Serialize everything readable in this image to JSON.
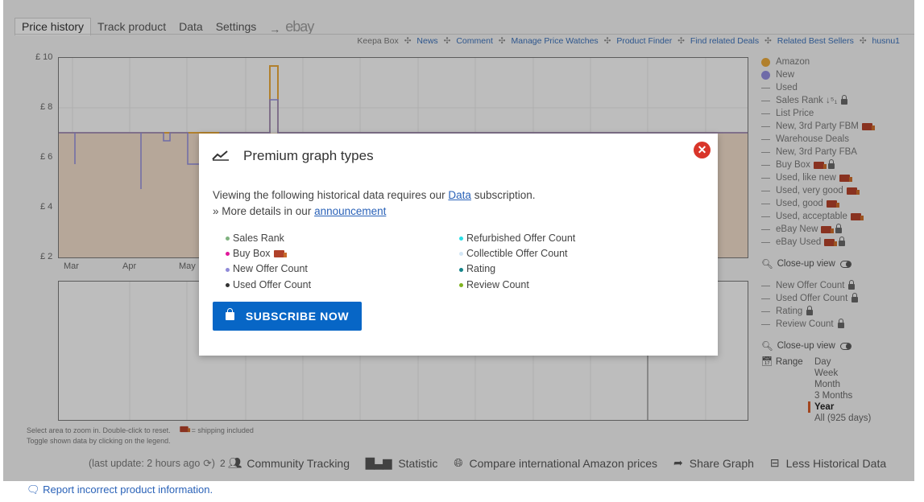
{
  "tabs": [
    {
      "label": "Price history",
      "active": true
    },
    {
      "label": "Track product"
    },
    {
      "label": "Data"
    },
    {
      "label": "Settings"
    }
  ],
  "tab_arrow": "→",
  "ebay_label": "ebay",
  "toplinks": {
    "keepa_box": "Keepa Box",
    "news": "News",
    "comment": "Comment",
    "manage": "Manage Price Watches",
    "finder": "Product Finder",
    "deals": "Find related Deals",
    "sellers": "Related Best Sellers",
    "user": "husnu1",
    "separator": "✣"
  },
  "chart1": {
    "yticks": [
      "£ 10",
      "£ 8",
      "£ 6",
      "£ 4",
      "£ 2"
    ],
    "xticks": [
      "Mar",
      "Apr",
      "May"
    ]
  },
  "legend": {
    "items": [
      {
        "label": "Amazon",
        "kind": "dot",
        "color": "#e3a53a"
      },
      {
        "label": "New",
        "kind": "dot",
        "color": "#8f8ad8"
      },
      {
        "label": "Used",
        "kind": "dash"
      },
      {
        "label": "Sales Rank ↓⁵₁",
        "kind": "dash",
        "lock": true
      },
      {
        "label": "List Price",
        "kind": "dash"
      },
      {
        "label": "New, 3rd Party FBM",
        "kind": "dash",
        "truck": true
      },
      {
        "label": "Warehouse Deals",
        "kind": "dash"
      },
      {
        "label": "New, 3rd Party FBA",
        "kind": "dash"
      },
      {
        "label": "Buy Box",
        "kind": "dash",
        "truck": true,
        "lock": true
      },
      {
        "label": "Used, like new",
        "kind": "dash",
        "truck": true
      },
      {
        "label": "Used, very good",
        "kind": "dash",
        "truck": true
      },
      {
        "label": "Used, good",
        "kind": "dash",
        "truck": true
      },
      {
        "label": "Used, acceptable",
        "kind": "dash",
        "truck": true
      },
      {
        "label": "eBay New",
        "kind": "dash",
        "truck": true,
        "lock": true
      },
      {
        "label": "eBay Used",
        "kind": "dash",
        "truck": true,
        "lock": true
      }
    ],
    "closeup_label": "Close-up view",
    "items2": [
      {
        "label": "New Offer Count",
        "lock": true
      },
      {
        "label": "Used Offer Count",
        "lock": true
      },
      {
        "label": "Rating",
        "lock": true
      },
      {
        "label": "Review Count",
        "lock": true
      }
    ]
  },
  "range": {
    "label": "Range",
    "options": [
      "Day",
      "Week",
      "Month",
      "3 Months",
      "Year",
      "All (925 days)"
    ],
    "selected": "Year"
  },
  "footnotes": {
    "line1": "Select area to zoom in. Double-click to reset.",
    "shipping": "= shipping included",
    "line2": "Toggle shown data by clicking on the legend."
  },
  "bottombar": {
    "last_update": "(last update: 2 hours ago",
    "tracking_count": "2",
    "tracking": "Community Tracking",
    "statistic": "Statistic",
    "compare": "Compare international Amazon prices",
    "share": "Share Graph",
    "less": "Less Historical Data"
  },
  "report": "Report incorrect product information.",
  "modal": {
    "title": "Premium graph types",
    "text1_pre": "Viewing the following historical data requires our ",
    "text1_link": "Data",
    "text1_post": " subscription.",
    "text2_pre": "» More details in our ",
    "text2_link": "announcement",
    "col1": [
      {
        "label": "Sales Rank",
        "color": "#7fb27f"
      },
      {
        "label": "Buy Box",
        "color": "#e0189a",
        "truck": true
      },
      {
        "label": "New Offer Count",
        "color": "#8f8ad8"
      },
      {
        "label": "Used Offer Count",
        "color": "#333333"
      }
    ],
    "col2": [
      {
        "label": "Refurbished Offer Count",
        "color": "#27dfe6"
      },
      {
        "label": "Collectible Offer Count",
        "color": "#d3e6f5"
      },
      {
        "label": "Rating",
        "color": "#15848a"
      },
      {
        "label": "Review Count",
        "color": "#7fb31f"
      }
    ],
    "subscribe": "SUBSCRIBE NOW"
  }
}
